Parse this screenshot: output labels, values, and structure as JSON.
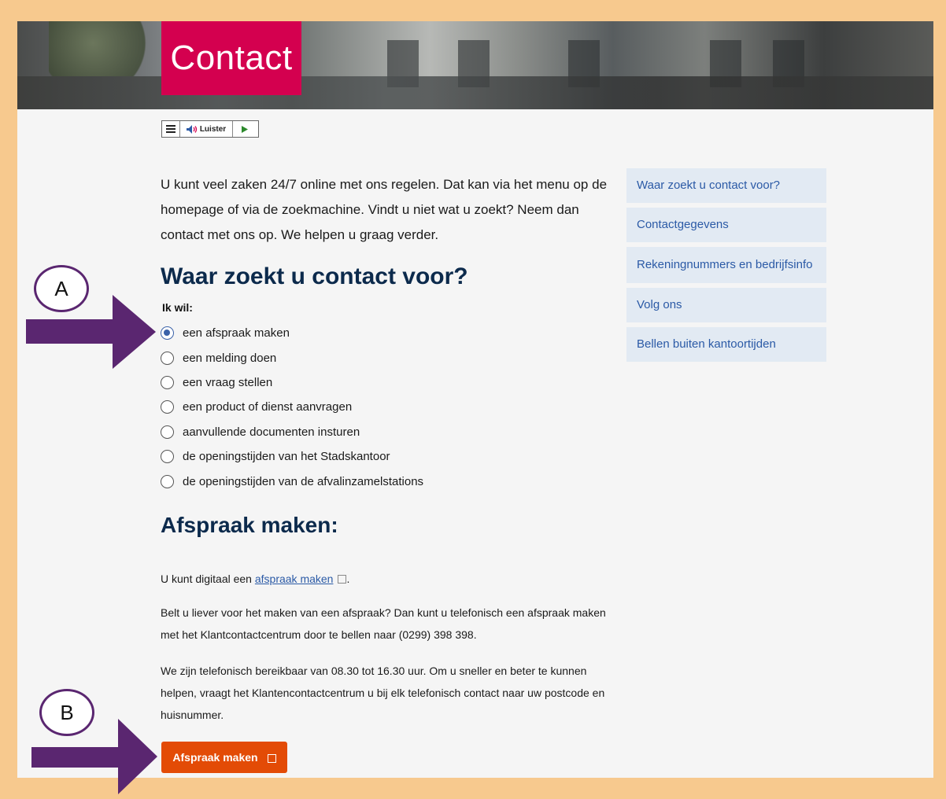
{
  "header": {
    "title": "Contact"
  },
  "tts": {
    "listen_label": "Luister"
  },
  "intro_text": "U kunt veel zaken 24/7 online met ons regelen. Dat kan via het menu op de homepage of via de zoekmachine. Vindt u niet wat u zoekt? Neem dan contact met ons op. We helpen u graag verder.",
  "section_main": {
    "heading": "Waar zoekt u contact voor?",
    "radio_label": "Ik wil:",
    "options": [
      "een afspraak maken",
      "een melding doen",
      "een vraag stellen",
      "een product of dienst aanvragen",
      "aanvullende documenten insturen",
      "de openingstijden van het Stadskantoor",
      "de openingstijden van de afvalinzamelstations"
    ],
    "selected_index": 0
  },
  "section_appointment": {
    "heading": "Afspraak maken:",
    "p1_prefix": "U kunt digitaal een ",
    "p1_link": "afspraak maken",
    "p1_suffix": ".",
    "p2": "Belt u liever voor het maken van een afspraak? Dan kunt u telefonisch een afspraak maken met het Klantcontactcentrum door te bellen naar (0299) 398 398.",
    "p3": "We zijn telefonisch bereikbaar van 08.30 tot 16.30 uur. Om u sneller en beter te kunnen helpen, vraagt het Klantencontactcentrum u bij elk telefonisch contact naar uw postcode en huisnummer.",
    "button_label": "Afspraak maken"
  },
  "sidebar": {
    "items": [
      {
        "label": "Waar zoekt u contact voor?"
      },
      {
        "label": "Contactgegevens"
      },
      {
        "label": "Rekeningnummers en bedrijfsinfo"
      },
      {
        "label": "Volg ons"
      },
      {
        "label": "Bellen buiten kantoortijden"
      }
    ]
  },
  "annotations": {
    "a": "A",
    "b": "B"
  },
  "colors": {
    "brand_red": "#d4004f",
    "button_orange": "#e34b06",
    "heading_navy": "#0c2a4c",
    "link_blue": "#2b5aa6",
    "annotation_purple": "#5a2670",
    "frame_orange": "#f7c98e"
  }
}
